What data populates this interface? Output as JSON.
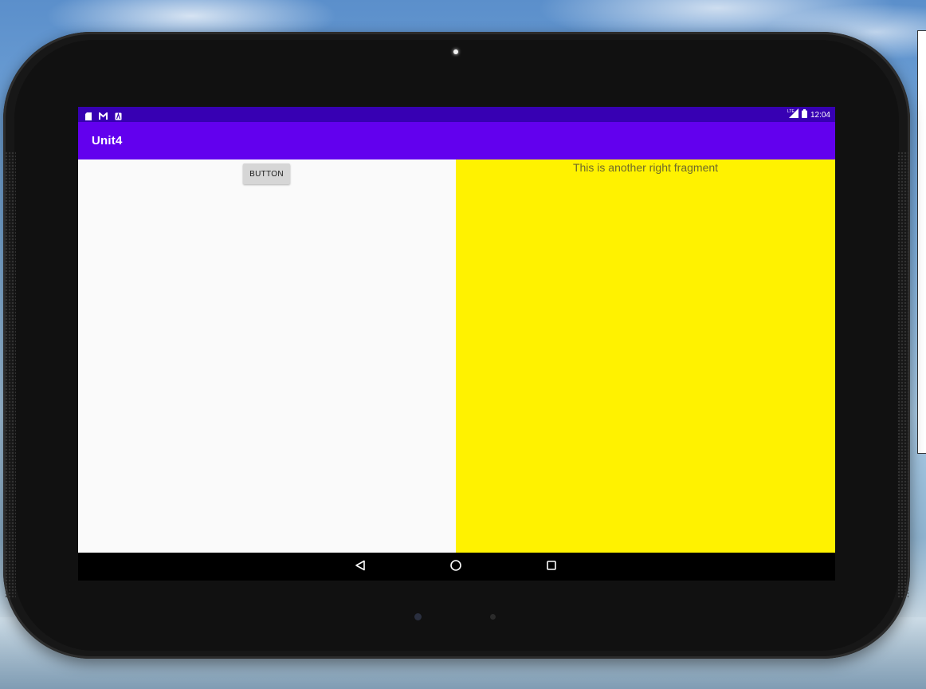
{
  "app": {
    "title": "Unit4"
  },
  "status_bar": {
    "left_icons": [
      "sd-card-icon",
      "n-notification-icon",
      "a-notification-icon"
    ],
    "network_label": "LTE",
    "time": "12:04"
  },
  "left_fragment": {
    "button_label": "BUTTON"
  },
  "right_fragment": {
    "text": "This is another right fragment",
    "background_color": "#fff200"
  },
  "nav_bar": {
    "buttons": [
      "back-icon",
      "home-icon",
      "recents-icon"
    ]
  },
  "colors": {
    "status_bar": "#3700b3",
    "app_bar": "#6200ee",
    "right_fragment": "#fff200",
    "nav_bar": "#000000"
  }
}
